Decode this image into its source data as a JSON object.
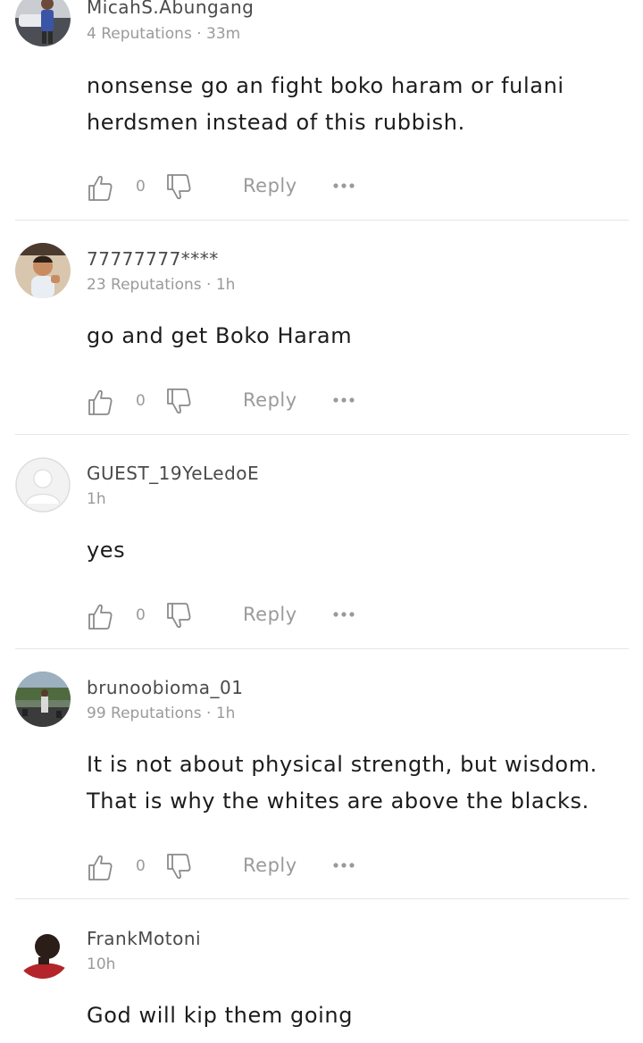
{
  "comments": [
    {
      "username": "MicahS.Abungang",
      "meta": "4 Reputations · 33m",
      "text": "nonsense go an fight boko haram or fulani herdsmen instead of this rubbish.",
      "likes": "0",
      "reply_label": "Reply",
      "avatar": "avatar-photo-man-with-car"
    },
    {
      "username": "77777777****",
      "meta": "23 Reputations · 1h",
      "text": "go and get Boko Haram",
      "likes": "0",
      "reply_label": "Reply",
      "avatar": "avatar-photo-child"
    },
    {
      "username": "GUEST_19YeLedoE",
      "meta": "1h",
      "text": "yes",
      "likes": "0",
      "reply_label": "Reply",
      "avatar": "avatar-default-placeholder"
    },
    {
      "username": "brunoobioma_01",
      "meta": "99 Reputations · 1h",
      "text": "It is not about physical strength, but wisdom. That is why the whites are above the blacks.",
      "likes": "0",
      "reply_label": "Reply",
      "avatar": "avatar-photo-man-outdoors"
    },
    {
      "username": "FrankMotoni",
      "meta": "10h",
      "text": "God will kip them going",
      "avatar": "avatar-photo-man-portrait"
    }
  ],
  "colors": {
    "text": "#1c1c1c",
    "muted": "#9a9a9a",
    "username": "#4a4a4a",
    "divider": "#e6e6e6"
  },
  "icons": [
    "thumbs-up-icon",
    "thumbs-down-icon",
    "more-options-icon"
  ]
}
